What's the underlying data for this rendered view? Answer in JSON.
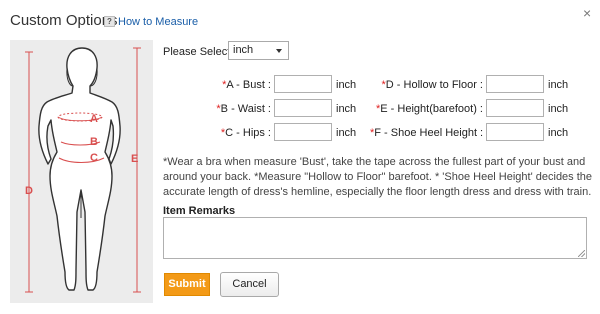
{
  "header": {
    "title": "Custom Options",
    "help_icon_glyph": "?",
    "how_to_measure": "How to Measure",
    "close_glyph": "×"
  },
  "figure": {
    "labels": {
      "a": "A",
      "b": "B",
      "c": "C",
      "d": "D",
      "e": "E"
    },
    "accent_color": "#d94f4f"
  },
  "form": {
    "select_label": "Please Select :",
    "unit_selected": "inch",
    "unit_word": "inch",
    "left": [
      {
        "req": "*",
        "label": "A - Bust :"
      },
      {
        "req": "*",
        "label": "B - Waist :"
      },
      {
        "req": "*",
        "label": "C - Hips :"
      }
    ],
    "right": [
      {
        "req": "*",
        "label": "D - Hollow to Floor :"
      },
      {
        "req": "*",
        "label": "E - Height(barefoot) :"
      },
      {
        "req": "*",
        "label": "F - Shoe Heel Height :"
      }
    ],
    "note": "*Wear a bra when measure 'Bust', take the tape across the fullest part of your bust and around your back. *Measure \"Hollow to Floor\" barefoot. * 'Shoe Heel Height' decides the accurate length of dress's hemline, especially the floor length dress and dress with train.",
    "remarks_label": "Item Remarks",
    "remarks_value": "",
    "submit_label": "Submit",
    "cancel_label": "Cancel",
    "submit_color": "#f39a17"
  }
}
